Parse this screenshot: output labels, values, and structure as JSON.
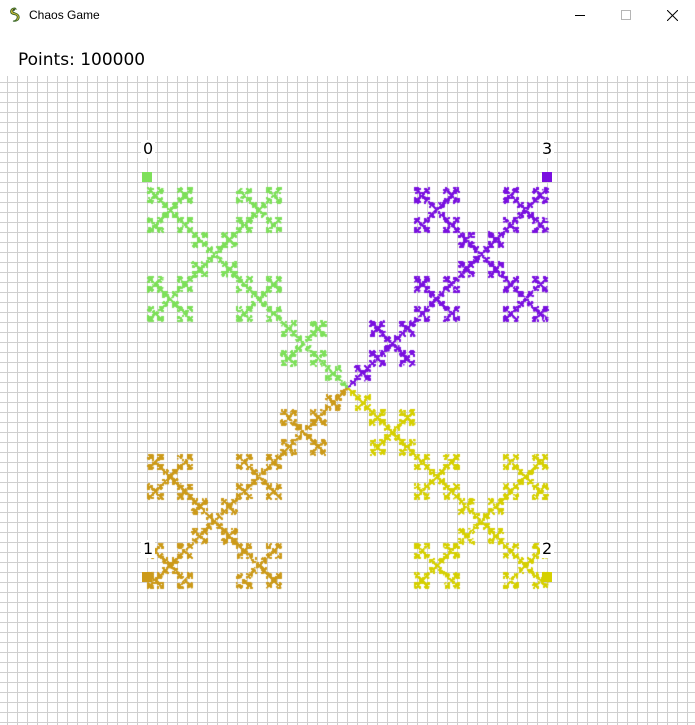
{
  "window": {
    "title": "Chaos Game",
    "icon": "pygame-snake-icon",
    "controls": [
      "minimize-icon",
      "maximize-icon",
      "close-icon"
    ]
  },
  "header": {
    "points_text": "Points: 100000"
  },
  "grid": {
    "line_color": "#cfcfcf",
    "background": "#ffffff"
  },
  "vertices": [
    {
      "label": "0",
      "color": "#7ee05a"
    },
    {
      "label": "1",
      "color": "#cc9a1a"
    },
    {
      "label": "2",
      "color": "#d6d000"
    },
    {
      "label": "3",
      "color": "#7a10e0"
    }
  ],
  "fractal": {
    "iterations_shown": 100000
  }
}
